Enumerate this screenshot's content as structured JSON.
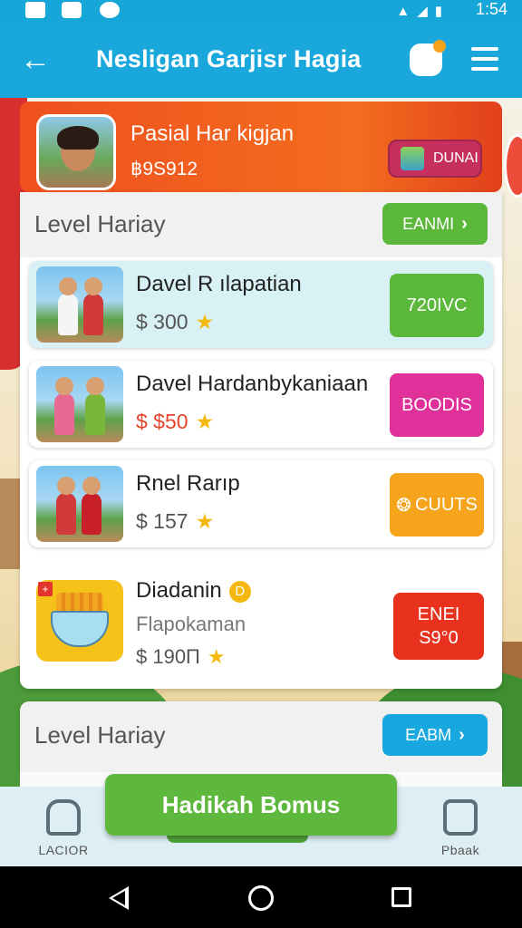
{
  "status_bar": {
    "time": "1:54"
  },
  "app_bar": {
    "title": "Nesligan Garjisr Hagia",
    "back_icon": "arrow-left-icon",
    "badge_icon": "gift-badge-icon",
    "menu_icon": "hamburger-menu-icon"
  },
  "profile": {
    "name": "Pasial Har kigjan",
    "code": "฿9S912",
    "button_label": "DUNAI"
  },
  "section1": {
    "label": "Level Hariay",
    "button_label": "EANMI"
  },
  "items": [
    {
      "title": "Davel R ılapatian",
      "price": "$ 300",
      "action": "720IVC",
      "action_color": "#5cb83a"
    },
    {
      "title": "Davel Hardanbykaniaan",
      "price": "$ $50",
      "action": "BOODIS",
      "action_color": "#e0309a"
    },
    {
      "title": "Rnel Rarıp",
      "price": "$ 157",
      "action": "CUUTS",
      "action_color": "#f5a41b"
    }
  ],
  "item4": {
    "title": "Diadanin",
    "coin": "D",
    "subtitle": "Flapokaman",
    "price": "$ 190П",
    "action_line1": "ENEI",
    "action_line2": "S9°0"
  },
  "section2": {
    "label": "Level Hariay",
    "button_label": "EABM"
  },
  "bonus_button": "Hadikah Bomus",
  "bottom_nav": {
    "left_label": "LACIOR",
    "right_label": "Pbaak"
  },
  "colors": {
    "primary": "#1aa8dc",
    "profile_bg": "#f0501e",
    "green": "#5eb83e",
    "blue_btn": "#19a7e0"
  }
}
